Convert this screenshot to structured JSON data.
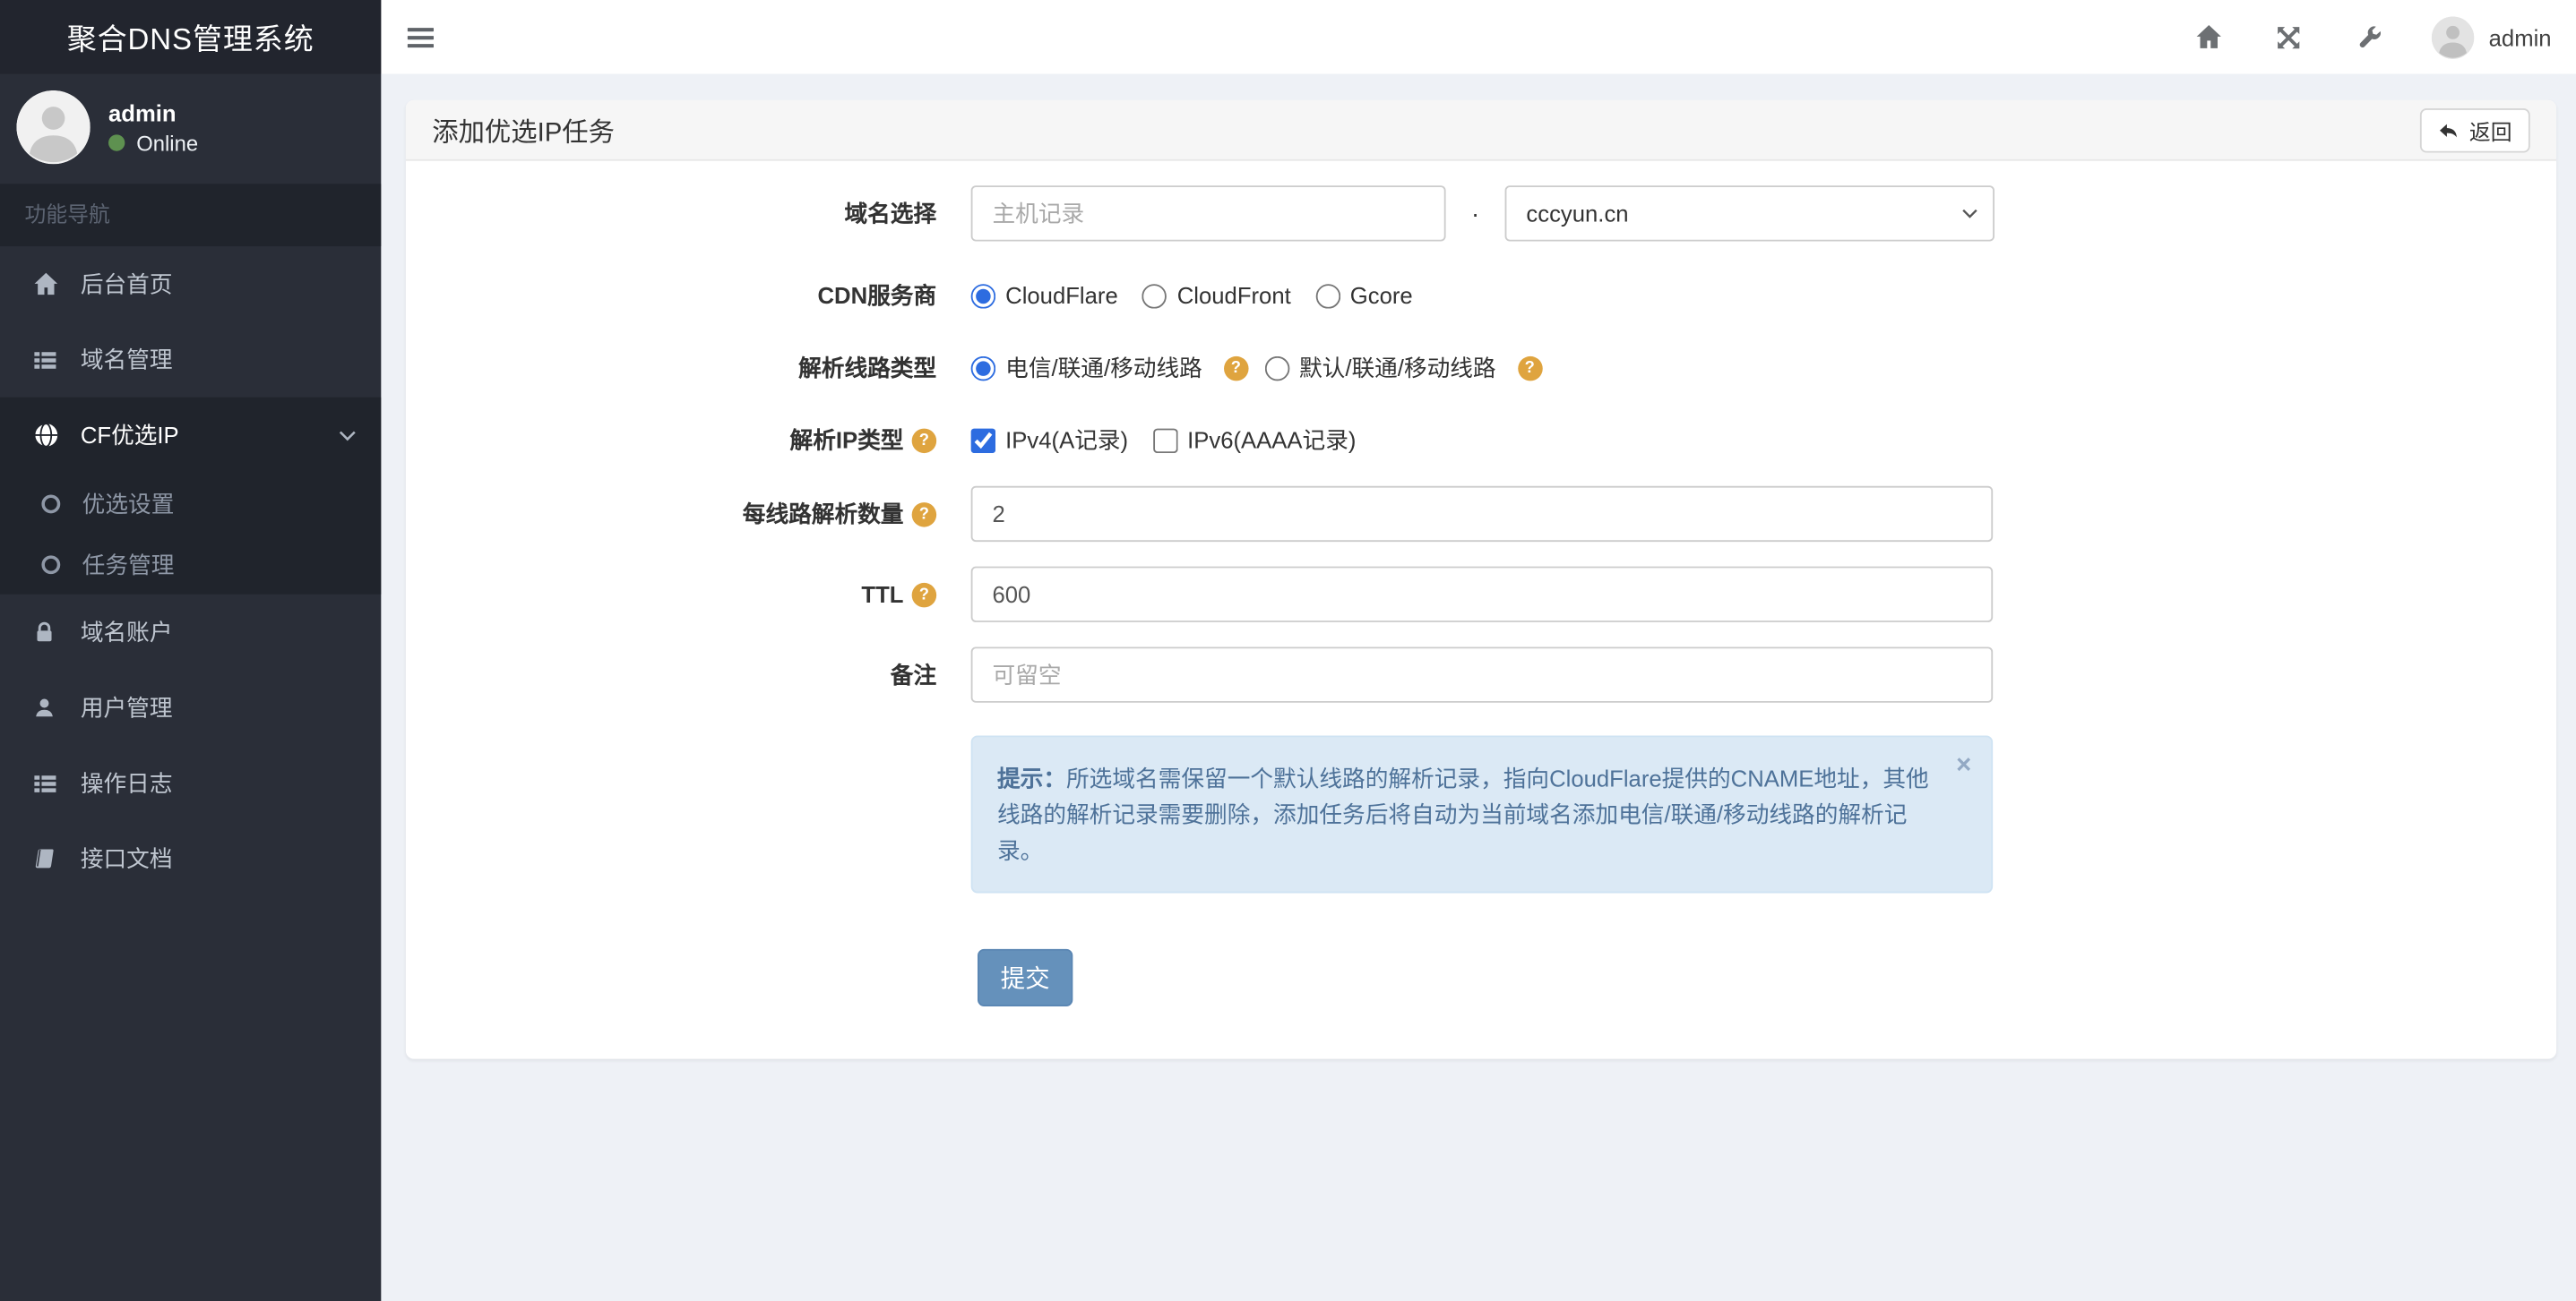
{
  "app": {
    "title": "聚合DNS管理系统"
  },
  "topbar": {
    "username": "admin"
  },
  "sidebar": {
    "user": {
      "name": "admin",
      "status": "Online"
    },
    "section_label": "功能导航",
    "items": [
      {
        "label": "后台首页",
        "icon": "home-icon"
      },
      {
        "label": "域名管理",
        "icon": "list-icon"
      },
      {
        "label": "CF优选IP",
        "icon": "globe-icon",
        "active": true,
        "children": [
          "优选设置",
          "任务管理"
        ]
      },
      {
        "label": "域名账户",
        "icon": "lock-icon"
      },
      {
        "label": "用户管理",
        "icon": "user-icon"
      },
      {
        "label": "操作日志",
        "icon": "list-icon"
      },
      {
        "label": "接口文档",
        "icon": "book-icon"
      }
    ]
  },
  "page": {
    "card_title": "添加优选IP任务",
    "back_button": "返回",
    "form": {
      "domain": {
        "label": "域名选择",
        "host_placeholder": "主机记录",
        "separator": ".",
        "selected_domain": "cccyun.cn"
      },
      "cdn": {
        "label": "CDN服务商",
        "options": [
          "CloudFlare",
          "CloudFront",
          "Gcore"
        ],
        "selected": "CloudFlare"
      },
      "line_type": {
        "label": "解析线路类型",
        "options": [
          "电信/联通/移动线路",
          "默认/联通/移动线路"
        ],
        "selected": "电信/联通/移动线路"
      },
      "ip_type": {
        "label": "解析IP类型",
        "options": [
          "IPv4(A记录)",
          "IPv6(AAAA记录)"
        ],
        "checked": [
          "IPv4(A记录)"
        ]
      },
      "per_line": {
        "label": "每线路解析数量",
        "value": "2"
      },
      "ttl": {
        "label": "TTL",
        "value": "600"
      },
      "remark": {
        "label": "备注",
        "placeholder": "可留空"
      },
      "tip": {
        "bold": "提示：",
        "text": "所选域名需保留一个默认线路的解析记录，指向CloudFlare提供的CNAME地址，其他线路的解析记录需要删除，添加任务后将自动为当前域名添加电信/联通/移动线路的解析记录。"
      },
      "submit_label": "提交"
    }
  },
  "icons": {
    "help": "?",
    "close": "×"
  },
  "colors": {
    "sidebar_bg": "#2a2e38",
    "sidebar_dark": "#20242c",
    "logo_bg": "#22252e",
    "online_green": "#5e9150",
    "accent_blue": "#2d6ce0",
    "help_orange": "#dfa43f",
    "alert_bg": "#dbe9f5",
    "alert_text": "#4e7299",
    "submit_blue": "#6591bb"
  }
}
